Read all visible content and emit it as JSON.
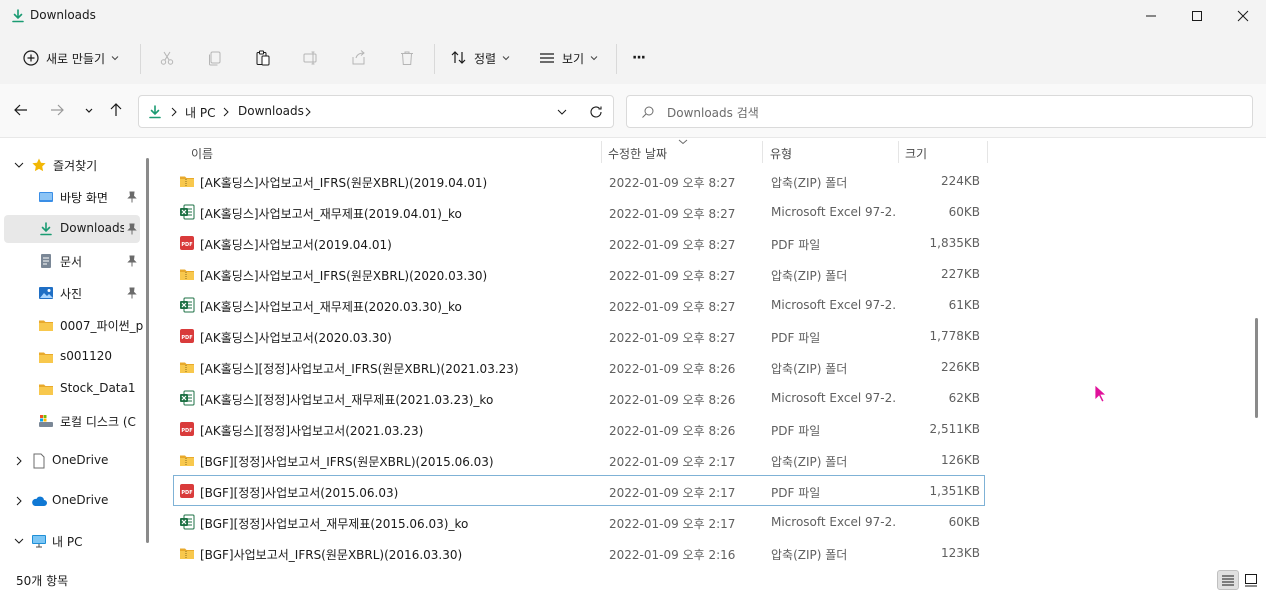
{
  "window": {
    "title": "Downloads"
  },
  "toolbar": {
    "new_label": "새로 만들기",
    "sort_label": "정렬",
    "view_label": "보기",
    "more_label": "···"
  },
  "address": {
    "crumbs": [
      "내 PC",
      "Downloads"
    ],
    "search_placeholder": "Downloads 검색"
  },
  "sidebar": {
    "items": [
      {
        "label": "즐겨찾기",
        "icon": "star-icon"
      },
      {
        "label": "바탕 화면",
        "icon": "desktop-icon",
        "pinned": true
      },
      {
        "label": "Downloads",
        "icon": "download-icon",
        "pinned": true,
        "selected": true
      },
      {
        "label": "문서",
        "icon": "document-icon",
        "pinned": true
      },
      {
        "label": "사진",
        "icon": "picture-icon",
        "pinned": true
      },
      {
        "label": "0007_파이썬_p",
        "icon": "folder-icon"
      },
      {
        "label": "s001120",
        "icon": "folder-icon"
      },
      {
        "label": "Stock_Data1",
        "icon": "folder-icon"
      },
      {
        "label": "로컬 디스크 (C",
        "icon": "drive-icon"
      },
      {
        "label": "OneDrive",
        "icon": "onedrive-file-icon"
      },
      {
        "label": "OneDrive",
        "icon": "onedrive-cloud-icon"
      },
      {
        "label": "내 PC",
        "icon": "pc-icon"
      }
    ]
  },
  "columns": {
    "name": "이름",
    "date": "수정한 날짜",
    "type": "유형",
    "size": "크기"
  },
  "files": [
    {
      "name": "[AK홀딩스]사업보고서_IFRS(원문XBRL)(2019.04.01)",
      "date": "2022-01-09 오후 8:27",
      "type": "압축(ZIP) 폴더",
      "size": "224KB",
      "kind": "zip"
    },
    {
      "name": "[AK홀딩스]사업보고서_재무제표(2019.04.01)_ko",
      "date": "2022-01-09 오후 8:27",
      "type": "Microsoft Excel 97-2...",
      "size": "60KB",
      "kind": "excel"
    },
    {
      "name": "[AK홀딩스]사업보고서(2019.04.01)",
      "date": "2022-01-09 오후 8:27",
      "type": "PDF 파일",
      "size": "1,835KB",
      "kind": "pdf"
    },
    {
      "name": "[AK홀딩스]사업보고서_IFRS(원문XBRL)(2020.03.30)",
      "date": "2022-01-09 오후 8:27",
      "type": "압축(ZIP) 폴더",
      "size": "227KB",
      "kind": "zip"
    },
    {
      "name": "[AK홀딩스]사업보고서_재무제표(2020.03.30)_ko",
      "date": "2022-01-09 오후 8:27",
      "type": "Microsoft Excel 97-2...",
      "size": "61KB",
      "kind": "excel"
    },
    {
      "name": "[AK홀딩스]사업보고서(2020.03.30)",
      "date": "2022-01-09 오후 8:27",
      "type": "PDF 파일",
      "size": "1,778KB",
      "kind": "pdf"
    },
    {
      "name": "[AK홀딩스][정정]사업보고서_IFRS(원문XBRL)(2021.03.23)",
      "date": "2022-01-09 오후 8:26",
      "type": "압축(ZIP) 폴더",
      "size": "226KB",
      "kind": "zip"
    },
    {
      "name": "[AK홀딩스][정정]사업보고서_재무제표(2021.03.23)_ko",
      "date": "2022-01-09 오후 8:26",
      "type": "Microsoft Excel 97-2...",
      "size": "62KB",
      "kind": "excel"
    },
    {
      "name": "[AK홀딩스][정정]사업보고서(2021.03.23)",
      "date": "2022-01-09 오후 8:26",
      "type": "PDF 파일",
      "size": "2,511KB",
      "kind": "pdf"
    },
    {
      "name": "[BGF][정정]사업보고서_IFRS(원문XBRL)(2015.06.03)",
      "date": "2022-01-09 오후 2:17",
      "type": "압축(ZIP) 폴더",
      "size": "126KB",
      "kind": "zip"
    },
    {
      "name": "[BGF][정정]사업보고서(2015.06.03)",
      "date": "2022-01-09 오후 2:17",
      "type": "PDF 파일",
      "size": "1,351KB",
      "kind": "pdf",
      "focused": true
    },
    {
      "name": "[BGF][정정]사업보고서_재무제표(2015.06.03)_ko",
      "date": "2022-01-09 오후 2:17",
      "type": "Microsoft Excel 97-2...",
      "size": "60KB",
      "kind": "excel"
    },
    {
      "name": "[BGF]사업보고서_IFRS(원문XBRL)(2016.03.30)",
      "date": "2022-01-09 오후 2:16",
      "type": "압축(ZIP) 폴더",
      "size": "123KB",
      "kind": "zip"
    }
  ],
  "status": {
    "item_count": "50개 항목"
  }
}
